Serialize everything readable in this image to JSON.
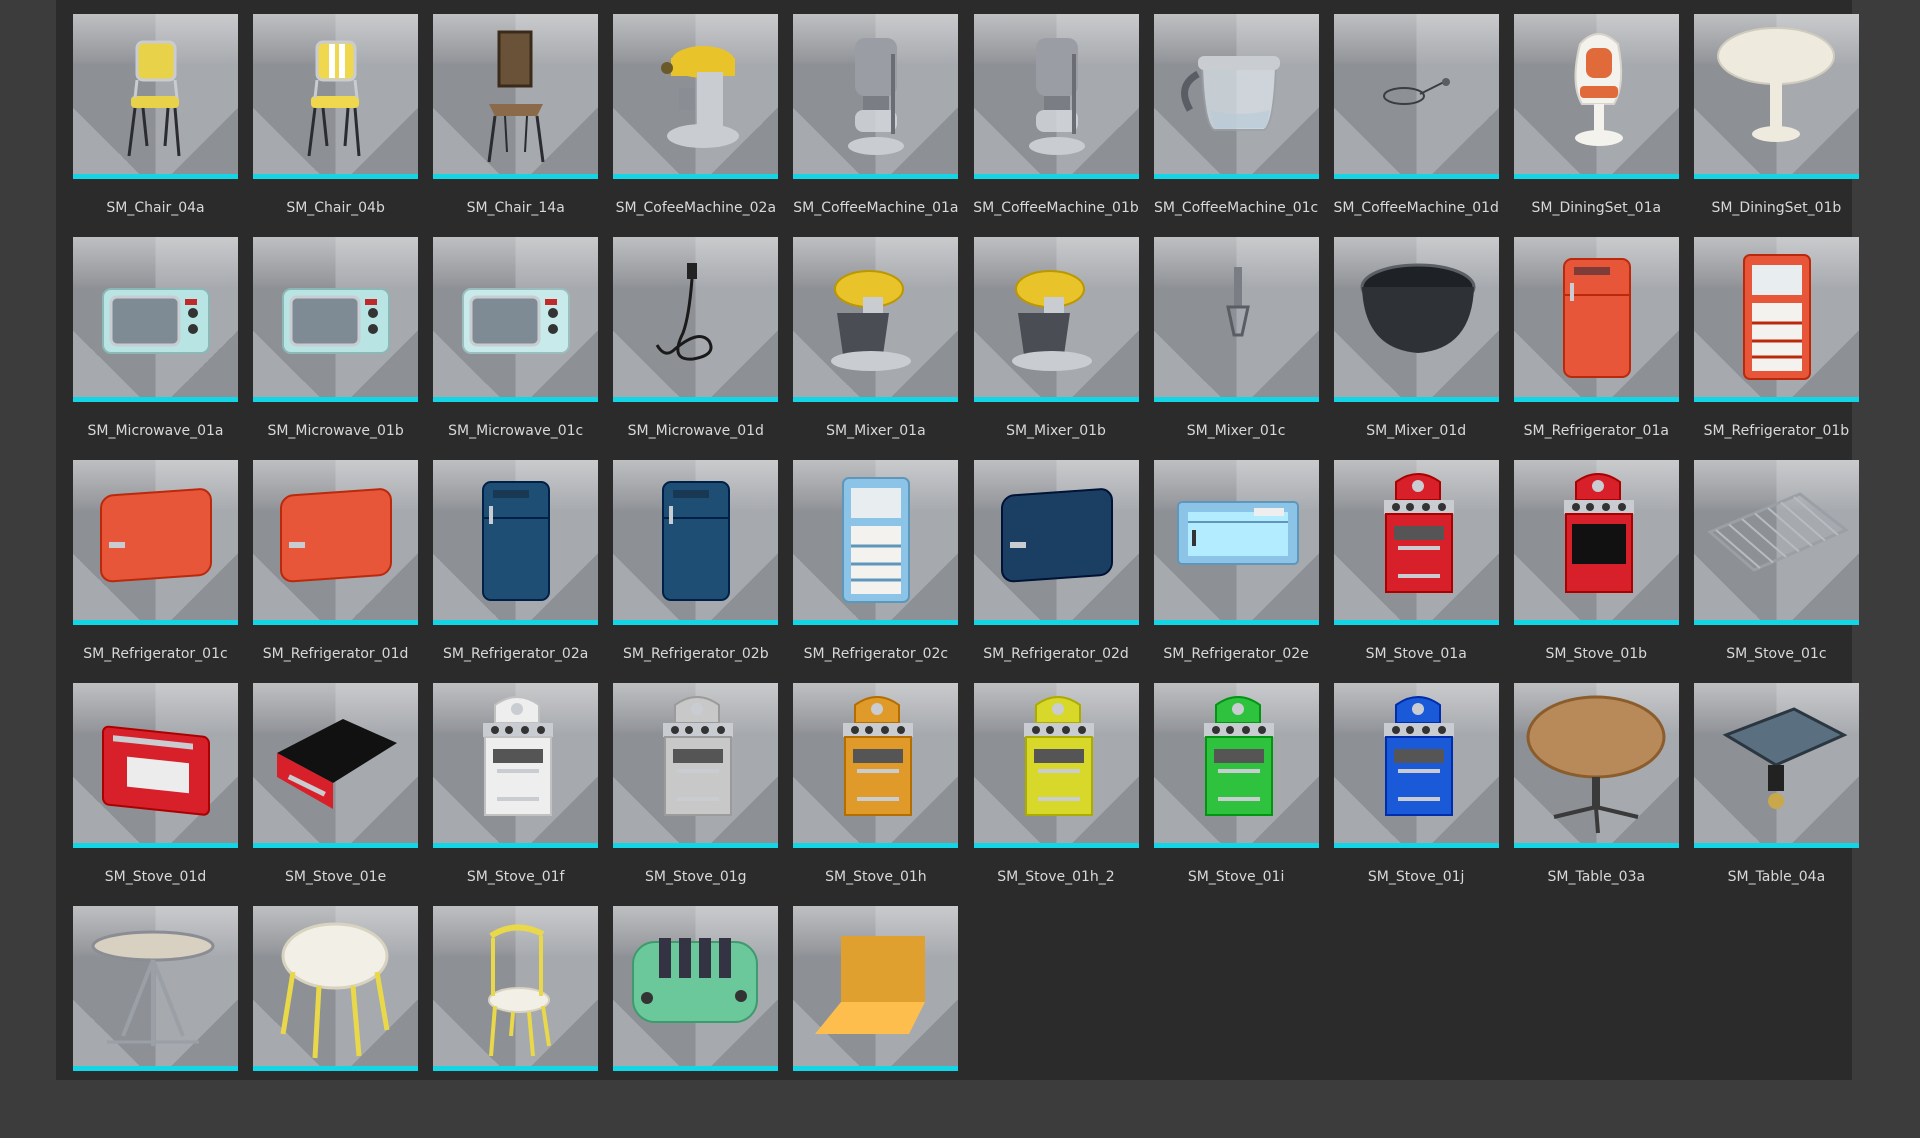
{
  "accent_color": "#12d6e6",
  "assets": [
    {
      "name": "SM_Chair_04a",
      "icon": "chair-yellow-icon",
      "color": "#e8d24a"
    },
    {
      "name": "SM_Chair_04b",
      "icon": "chair-yellow-stripe-icon",
      "color": "#f0d84e"
    },
    {
      "name": "SM_Chair_14a",
      "icon": "chair-brown-icon",
      "color": "#8a6a48"
    },
    {
      "name": "SM_CofeeMachine_02a",
      "icon": "coffee-machine-yellow-icon",
      "color": "#e8c42a"
    },
    {
      "name": "SM_CoffeeMachine_01a",
      "icon": "coffee-machine-icon",
      "color": "#9a9ea4"
    },
    {
      "name": "SM_CoffeeMachine_01b",
      "icon": "coffee-machine-icon",
      "color": "#9a9ea4"
    },
    {
      "name": "SM_CoffeeMachine_01c",
      "icon": "coffee-pot-icon",
      "color": "#c8ccd0"
    },
    {
      "name": "SM_CoffeeMachine_01d",
      "icon": "cable-icon",
      "color": "#555a60"
    },
    {
      "name": "SM_DiningSet_01a",
      "icon": "tulip-chair-icon",
      "color": "#e06a3a"
    },
    {
      "name": "SM_DiningSet_01b",
      "icon": "tulip-table-icon",
      "color": "#eeeade"
    },
    {
      "name": "SM_Microwave_01a",
      "icon": "microwave-icon",
      "color": "#b8e4e4"
    },
    {
      "name": "SM_Microwave_01b",
      "icon": "microwave-icon",
      "color": "#b8e4e4"
    },
    {
      "name": "SM_Microwave_01c",
      "icon": "microwave-icon",
      "color": "#c8eaea"
    },
    {
      "name": "SM_Microwave_01d",
      "icon": "cable-icon",
      "color": "#2a2a2a"
    },
    {
      "name": "SM_Mixer_01a",
      "icon": "mixer-icon",
      "color": "#e8c42a"
    },
    {
      "name": "SM_Mixer_01b",
      "icon": "mixer-icon",
      "color": "#e8c42a"
    },
    {
      "name": "SM_Mixer_01c",
      "icon": "whisk-icon",
      "color": "#7a7e84"
    },
    {
      "name": "SM_Mixer_01d",
      "icon": "bowl-icon",
      "color": "#2e3236"
    },
    {
      "name": "SM_Refrigerator_01a",
      "icon": "refrigerator-icon",
      "color": "#e8563a"
    },
    {
      "name": "SM_Refrigerator_01b",
      "icon": "refrigerator-open-icon",
      "color": "#e8563a"
    },
    {
      "name": "SM_Refrigerator_01c",
      "icon": "refrigerator-door-icon",
      "color": "#e8563a"
    },
    {
      "name": "SM_Refrigerator_01d",
      "icon": "refrigerator-door-icon",
      "color": "#e8563a"
    },
    {
      "name": "SM_Refrigerator_02a",
      "icon": "refrigerator-icon",
      "color": "#1f4e74"
    },
    {
      "name": "SM_Refrigerator_02b",
      "icon": "refrigerator-icon",
      "color": "#1f4e74"
    },
    {
      "name": "SM_Refrigerator_02c",
      "icon": "refrigerator-open-icon",
      "color": "#8cc4e8"
    },
    {
      "name": "SM_Refrigerator_02d",
      "icon": "refrigerator-door-icon",
      "color": "#1a3f62"
    },
    {
      "name": "SM_Refrigerator_02e",
      "icon": "freezer-door-icon",
      "color": "#8cc4e8"
    },
    {
      "name": "SM_Stove_01a",
      "icon": "stove-icon",
      "color": "#d8202a"
    },
    {
      "name": "SM_Stove_01b",
      "icon": "stove-open-icon",
      "color": "#d8202a"
    },
    {
      "name": "SM_Stove_01c",
      "icon": "oven-rack-icon",
      "color": "#b8bcc0"
    },
    {
      "name": "SM_Stove_01d",
      "icon": "oven-door-icon",
      "color": "#d8202a"
    },
    {
      "name": "SM_Stove_01e",
      "icon": "oven-drawer-icon",
      "color": "#d8202a"
    },
    {
      "name": "SM_Stove_01f",
      "icon": "stove-icon",
      "color": "#eeeeee"
    },
    {
      "name": "SM_Stove_01g",
      "icon": "stove-icon",
      "color": "#c8c8c8"
    },
    {
      "name": "SM_Stove_01h",
      "icon": "stove-icon",
      "color": "#e09a2a"
    },
    {
      "name": "SM_Stove_01h_2",
      "icon": "stove-icon",
      "color": "#d8d82a"
    },
    {
      "name": "SM_Stove_01i",
      "icon": "stove-icon",
      "color": "#2ec23e"
    },
    {
      "name": "SM_Stove_01j",
      "icon": "stove-icon",
      "color": "#1a5ad8"
    },
    {
      "name": "SM_Table_03a",
      "icon": "round-table-icon",
      "color": "#b88a5a"
    },
    {
      "name": "SM_Table_04a",
      "icon": "square-table-icon",
      "color": "#5a7080"
    },
    {
      "name": "",
      "icon": "round-table-chrome-icon",
      "color": "#d8d0c0"
    },
    {
      "name": "",
      "icon": "round-table-yellow-icon",
      "color": "#e8d84a"
    },
    {
      "name": "",
      "icon": "chair-yellow-round-icon",
      "color": "#e8d84a"
    },
    {
      "name": "",
      "icon": "toaster-icon",
      "color": "#6ac89a"
    },
    {
      "name": "",
      "icon": "floor-panel-icon",
      "color": "#e0a030"
    }
  ]
}
